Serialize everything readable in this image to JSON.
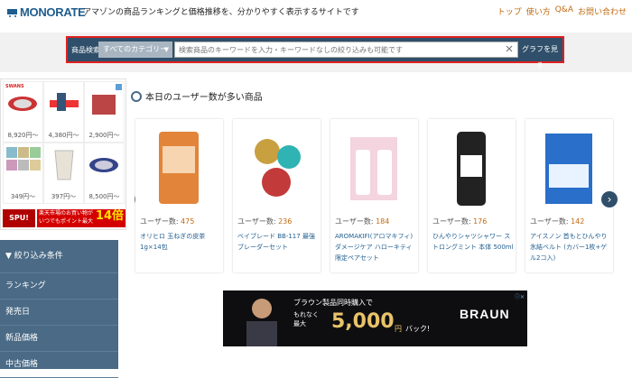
{
  "header": {
    "logo_text": "MONORATE",
    "tagline": "アマゾンの商品ランキングと価格推移を、分かりやすく表示するサイトです",
    "nav": [
      "トップ",
      "使い方",
      "Q&A",
      "お問い合わせ"
    ]
  },
  "search": {
    "label": "商品検索",
    "category": "すべてのカテゴリー",
    "placeholder": "検索商品のキーワードを入力・キーワードなしの絞り込みも可能です",
    "button": "グラフを見る"
  },
  "ad": {
    "prices": [
      "8,920円〜",
      "4,380円〜",
      "2,900円〜",
      "349円〜",
      "397円〜",
      "8,500円〜"
    ],
    "logo": "SWANS",
    "spu_badge": "SPU!",
    "spu_line1": "楽天市場のお買い物が",
    "spu_line2": "いつでもポイント最大",
    "spu_big": "14倍"
  },
  "sidebar": {
    "header": "絞り込み条件",
    "items": [
      "ランキング",
      "発売日",
      "新品価格",
      "中古価格"
    ]
  },
  "section": {
    "title": "本日のユーザー数が多い商品"
  },
  "products": [
    {
      "user_label": "ユーザー数:",
      "user_count": "475",
      "title": "オリヒロ 玉ねぎの皮茶 1g×14包",
      "img_color": "#e2843a"
    },
    {
      "user_label": "ユーザー数:",
      "user_count": "236",
      "title": "ベイブレード BB-117 最強ブレーダーセット",
      "img_color": "#c33a3a"
    },
    {
      "user_label": "ユーザー数:",
      "user_count": "184",
      "title": "AROMAKIFI(アロマキフィ) ダメージケア ハローキティ限定ペアセット",
      "img_color": "#e07a9a"
    },
    {
      "user_label": "ユーザー数:",
      "user_count": "176",
      "title": "ひんやりシャツシャワー ストロングミント 本体 500ml",
      "img_color": "#222222"
    },
    {
      "user_label": "ユーザー数:",
      "user_count": "142",
      "title": "アイスノン 首もとひんやり氷結ベルト (カバー1枚+ゲル2コ入)",
      "img_color": "#2a6fc9"
    }
  ],
  "banner": {
    "line1": "ブラウン製品同時購入で",
    "line2a": "もれなく",
    "line2b": "最大",
    "amount": "5,000",
    "yen": "円",
    "pack": "バック!",
    "brand": "BRAUN"
  },
  "colors": {
    "accent": "#2f4f6a",
    "highlight": "#e02020",
    "link": "#1f5d8f",
    "count": "#c06a10"
  }
}
